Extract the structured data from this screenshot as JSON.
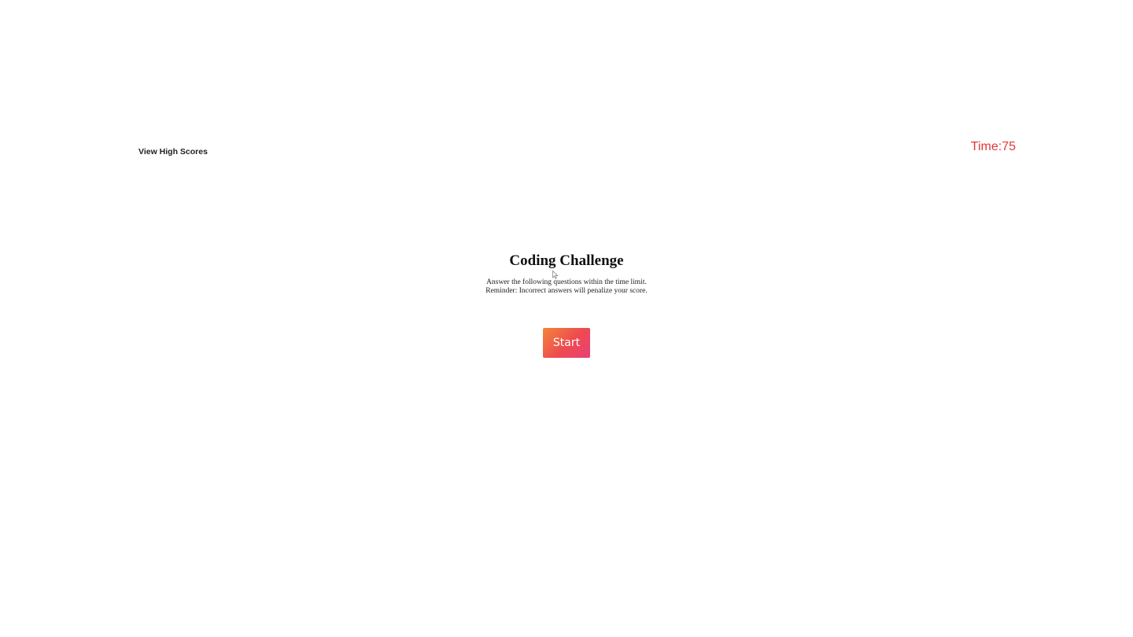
{
  "header": {
    "highscores_label": "View High Scores",
    "timer_label": "Time:75"
  },
  "intro": {
    "title": "Coding Challenge",
    "line1": "Answer the following questions within the time limit.",
    "line2": "Reminder: Incorrect answers will penalize your score."
  },
  "start_button": {
    "label": "Start"
  },
  "colors": {
    "timer": "#e0393a",
    "start_gradient_start": "#f3853b",
    "start_gradient_end": "#e8417a"
  },
  "icons": {
    "cursor": "mouse-pointer-icon"
  }
}
